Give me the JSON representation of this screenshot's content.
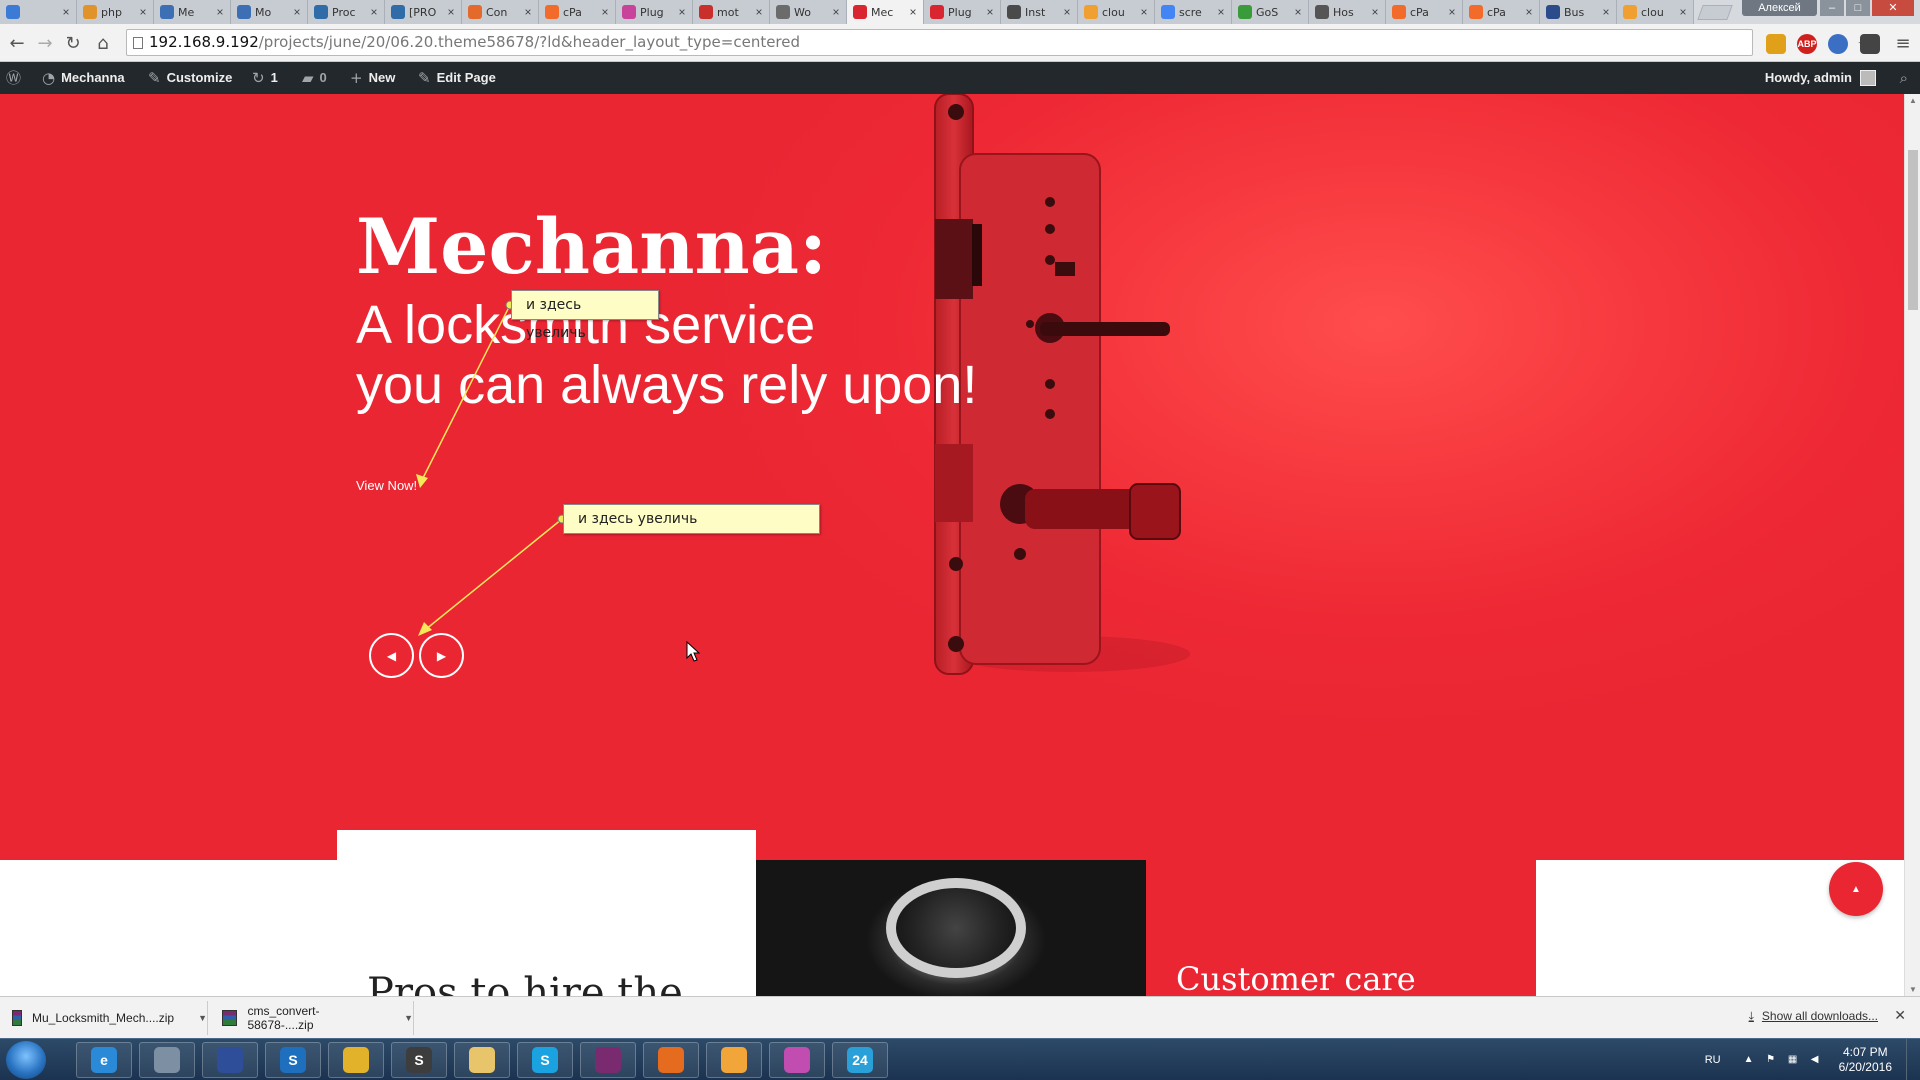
{
  "browser": {
    "tabs": [
      {
        "label": "",
        "favicon_color": "#3b7bd6"
      },
      {
        "label": "php",
        "favicon_color": "#e0932a"
      },
      {
        "label": "Me",
        "favicon_color": "#3d6fb5"
      },
      {
        "label": "Mo",
        "favicon_color": "#3d6fb5"
      },
      {
        "label": "Proc",
        "favicon_color": "#2f6ca8"
      },
      {
        "label": "[PRO",
        "favicon_color": "#2f6ca8"
      },
      {
        "label": "Con",
        "favicon_color": "#e46a2c"
      },
      {
        "label": "cPa",
        "favicon_color": "#f26b2a"
      },
      {
        "label": "Plug",
        "favicon_color": "#c8449b"
      },
      {
        "label": "mot",
        "favicon_color": "#c9302c"
      },
      {
        "label": "Wo",
        "favicon_color": "#6b6b6b"
      },
      {
        "label": "Mec",
        "favicon_color": "#d9252f",
        "active": true
      },
      {
        "label": "Plug",
        "favicon_color": "#d9252f"
      },
      {
        "label": "Inst",
        "favicon_color": "#4a4a4a"
      },
      {
        "label": "clou",
        "favicon_color": "#f0a030"
      },
      {
        "label": "scre",
        "favicon_color": "#4285f4"
      },
      {
        "label": "GoS",
        "favicon_color": "#3a9b3a"
      },
      {
        "label": "Hos",
        "favicon_color": "#555555"
      },
      {
        "label": "cPa",
        "favicon_color": "#f26b2a"
      },
      {
        "label": "cPa",
        "favicon_color": "#f26b2a"
      },
      {
        "label": "Bus",
        "favicon_color": "#2b4b8a"
      },
      {
        "label": "clou",
        "favicon_color": "#f0a030"
      }
    ],
    "profile_name": "Алексей",
    "url_host": "192.168.9.192",
    "url_path": "/projects/june/20/06.20.theme58678/?ld&header_layout_type=centered",
    "extensions": [
      {
        "label": "",
        "color": "#e0a01a"
      },
      {
        "label": "ABP",
        "color": "#d0201e"
      },
      {
        "label": "",
        "color": "#3a6fc4"
      },
      {
        "label": "",
        "color": "#444444"
      }
    ]
  },
  "admin_bar": {
    "site_name": "Mechanna",
    "customize": "Customize",
    "updates": "1",
    "comments": "0",
    "new": "New",
    "edit_page": "Edit Page",
    "howdy": "Howdy, admin"
  },
  "hero": {
    "title": "Mechanna:",
    "subtitle_line1": "A locksmith service",
    "subtitle_line2": "you can always rely upon!",
    "cta": "View Now!",
    "accent_color": "#ea2633"
  },
  "annotations": [
    {
      "text": "и здесь увеличь"
    },
    {
      "text": "и здесь увеличь"
    }
  ],
  "sections": {
    "card_left_title": "Pros to hire the",
    "card_right_title": "Customer care"
  },
  "downloads": {
    "items": [
      {
        "name": "Mu_Locksmith_Mech....zip"
      },
      {
        "name": "cms_convert-58678-....zip"
      }
    ],
    "show_all": "Show all downloads..."
  },
  "taskbar": {
    "apps": [
      {
        "name": "internet-explorer",
        "glyph": "e",
        "color": "#2a8ad8"
      },
      {
        "name": "calculator",
        "glyph": "",
        "color": "#7d8fa3"
      },
      {
        "name": "floppy",
        "glyph": "",
        "color": "#2e4e9a"
      },
      {
        "name": "s-app",
        "glyph": "S",
        "color": "#1f6fbf"
      },
      {
        "name": "chrome",
        "glyph": "",
        "color": "#e2b32a"
      },
      {
        "name": "sublime-text",
        "glyph": "S",
        "color": "#3d3d3d"
      },
      {
        "name": "file-explorer",
        "glyph": "",
        "color": "#e8c56a"
      },
      {
        "name": "skype",
        "glyph": "S",
        "color": "#1aa3e0"
      },
      {
        "name": "winrar",
        "glyph": "",
        "color": "#7a2a6e"
      },
      {
        "name": "firefox",
        "glyph": "",
        "color": "#e56b1f"
      },
      {
        "name": "image-viewer",
        "glyph": "",
        "color": "#f2a63a"
      },
      {
        "name": "paint",
        "glyph": "",
        "color": "#c24db0"
      },
      {
        "name": "clock-24",
        "glyph": "24",
        "color": "#2aa0d8"
      }
    ],
    "language": "RU",
    "time": "4:07 PM",
    "date": "6/20/2016"
  }
}
